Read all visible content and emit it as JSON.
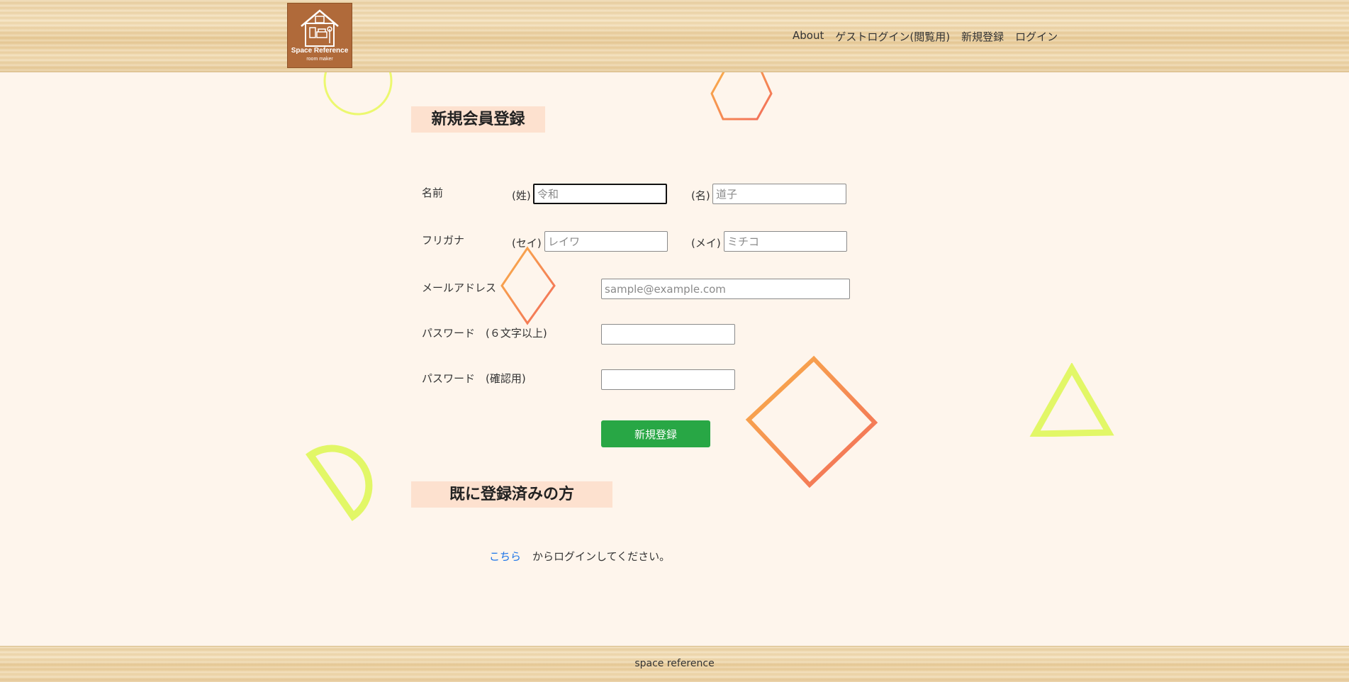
{
  "header": {
    "logo": {
      "title": "Space Reference",
      "subtitle": "room maker",
      "icon": "house-icon"
    },
    "nav": [
      {
        "label": "About"
      },
      {
        "label": "ゲストログイン(閲覧用)"
      },
      {
        "label": "新規登録"
      },
      {
        "label": "ログイン"
      }
    ]
  },
  "signup": {
    "heading": "新規会員登録",
    "name": {
      "label": "名前",
      "last_prefix": "(姓)",
      "last_placeholder": "令和",
      "first_prefix": "(名)",
      "first_placeholder": "道子"
    },
    "kana": {
      "label": "フリガナ",
      "last_prefix": "(セイ)",
      "last_placeholder": "レイワ",
      "first_prefix": "(メイ)",
      "first_placeholder": "ミチコ"
    },
    "email": {
      "label": "メールアドレス",
      "placeholder": "sample@example.com"
    },
    "password": {
      "label": "パスワード　(６文字以上)"
    },
    "password_confirm": {
      "label": "パスワード　(確認用)"
    },
    "submit_label": "新規登録"
  },
  "existing": {
    "heading": "既に登録済みの方",
    "link_text": "こちら",
    "suffix_text": "からログインしてください。"
  },
  "footer": {
    "text": "space reference"
  },
  "colors": {
    "background": "#fef5ec",
    "heading_bg": "#fde1cf",
    "submit_button": "#28a745",
    "link": "#1a73e8",
    "logo_bg": "#b06a3a",
    "shape_yellow": "#e8f562",
    "shape_orange": "#f9a23c",
    "shape_red": "#f26b5b"
  }
}
